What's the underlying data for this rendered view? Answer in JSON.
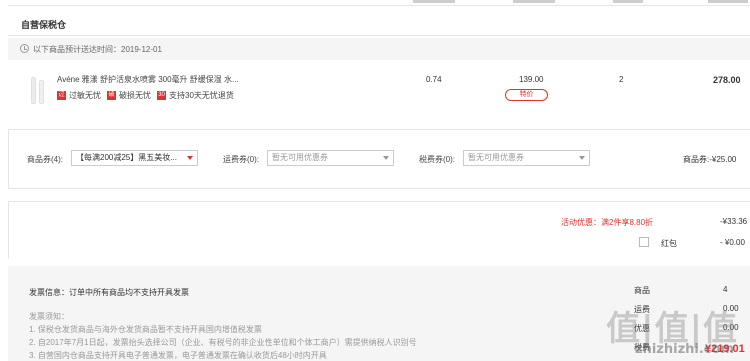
{
  "warehouse": {
    "title": "自营保税仓",
    "delivery_text": "以下商品预计送达时间：2019-12-01"
  },
  "product": {
    "name": "Avène 雅漾 舒护活泉水喷雾 300毫升 舒缓保湿 水...",
    "tags": [
      {
        "icon": "过",
        "label": "过敏无忧"
      },
      {
        "icon": "破",
        "label": "破损无忧"
      },
      {
        "icon": "30",
        "label": "支持30天无忧退货"
      }
    ],
    "tax": "0.74",
    "price": "139.00",
    "price_badge": "特价",
    "quantity": "2",
    "total": "278.00"
  },
  "coupons": {
    "product_coupon_label": "商品券(4):",
    "product_coupon_value": "【每满200减25】黑五美妆...",
    "shipping_coupon_label": "运费券(0):",
    "shipping_coupon_value": "暂无可用优惠券",
    "tax_coupon_label": "税费券(0):",
    "tax_coupon_value": "暂无可用优惠券",
    "product_coupon_sum": "商品券:-¥25.00"
  },
  "discounts": {
    "activity_label": "活动优惠：满2件享8.80折",
    "activity_value": "-¥33.36",
    "hongbao_label": "红包",
    "hongbao_value": "- ¥0.00"
  },
  "invoice": {
    "info": "发票信息：订单中所有商品均不支持开具发票",
    "notes_title": "发票须知：",
    "notes": [
      "1. 保税仓发货商品与海外仓发货商品暂不支持开具国内增值税发票",
      "2. 自2017年7月1日起，发票抬头选择公司（企业、有税号的非企业性单位和个体工商户）需提供纳税人识别号",
      "3. 自营国内仓商品支持开具电子普通发票，电子普通发票在确认收货后48小时内开具"
    ],
    "summary_rows": [
      {
        "label": "商品",
        "value": "4"
      },
      {
        "label": "运费",
        "value": "0.00"
      },
      {
        "label": "优惠",
        "value": "0.00"
      },
      {
        "label": "税费",
        "value": "0.00"
      }
    ],
    "grand_total": "¥219.01"
  },
  "watermark": {
    "logo": "值|值|值",
    "url": "zhizhizhi.com"
  },
  "colors": {
    "accent": "#dd3333",
    "muted_bg": "#f5f5f5",
    "border": "#e6e6e6"
  }
}
